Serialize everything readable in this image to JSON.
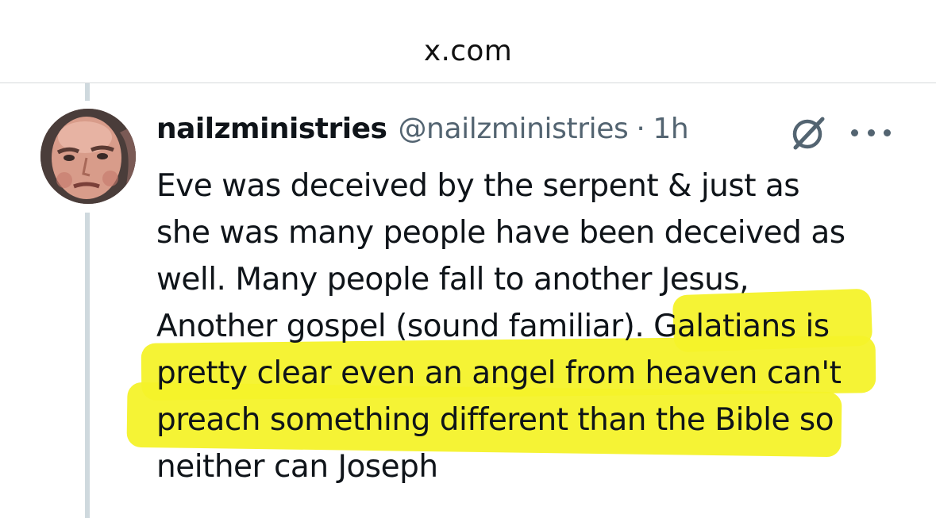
{
  "browser": {
    "url": "x.com"
  },
  "tweet": {
    "display_name": "nailzministries",
    "handle": "@nailzministries",
    "separator": "·",
    "time": "1h",
    "lines": [
      "Eve was deceived by the serpent & just as",
      "she was many people have been deceived as",
      "well. Many people fall to another Jesus,",
      "Another gospel (sound familiar). Galatians is",
      "pretty clear even an angel from heaven can't",
      "preach something different than the Bible so",
      "neither can Joseph"
    ],
    "highlight_color": "#f4f22a"
  },
  "icons": {
    "avatar": "avatar",
    "grok": "grok-icon",
    "more": "more-icon"
  }
}
